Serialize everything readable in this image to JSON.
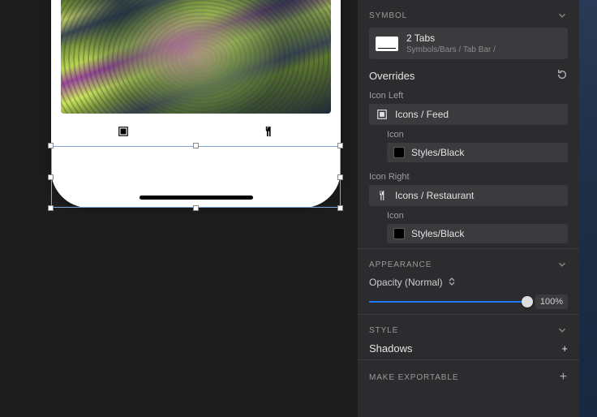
{
  "inspector": {
    "symbol": {
      "header": "Symbol",
      "title": "2 Tabs",
      "path": "Symbols/Bars / Tab Bar /"
    },
    "overrides": {
      "title": "Overrides",
      "iconLeft": {
        "label": "Icon Left",
        "value": "Icons / Feed",
        "fill": {
          "label": "Icon",
          "value": "Styles/Black"
        }
      },
      "iconRight": {
        "label": "Icon Right",
        "value": "Icons / Restaurant",
        "fill": {
          "label": "Icon",
          "value": "Styles/Black"
        }
      }
    },
    "appearance": {
      "header": "Appearance",
      "opacityLabel": "Opacity (Normal)",
      "opacityValue": "100%"
    },
    "style": {
      "header": "Style",
      "shadowsLabel": "Shadows"
    },
    "exportable": {
      "header": "Make Exportable"
    }
  }
}
